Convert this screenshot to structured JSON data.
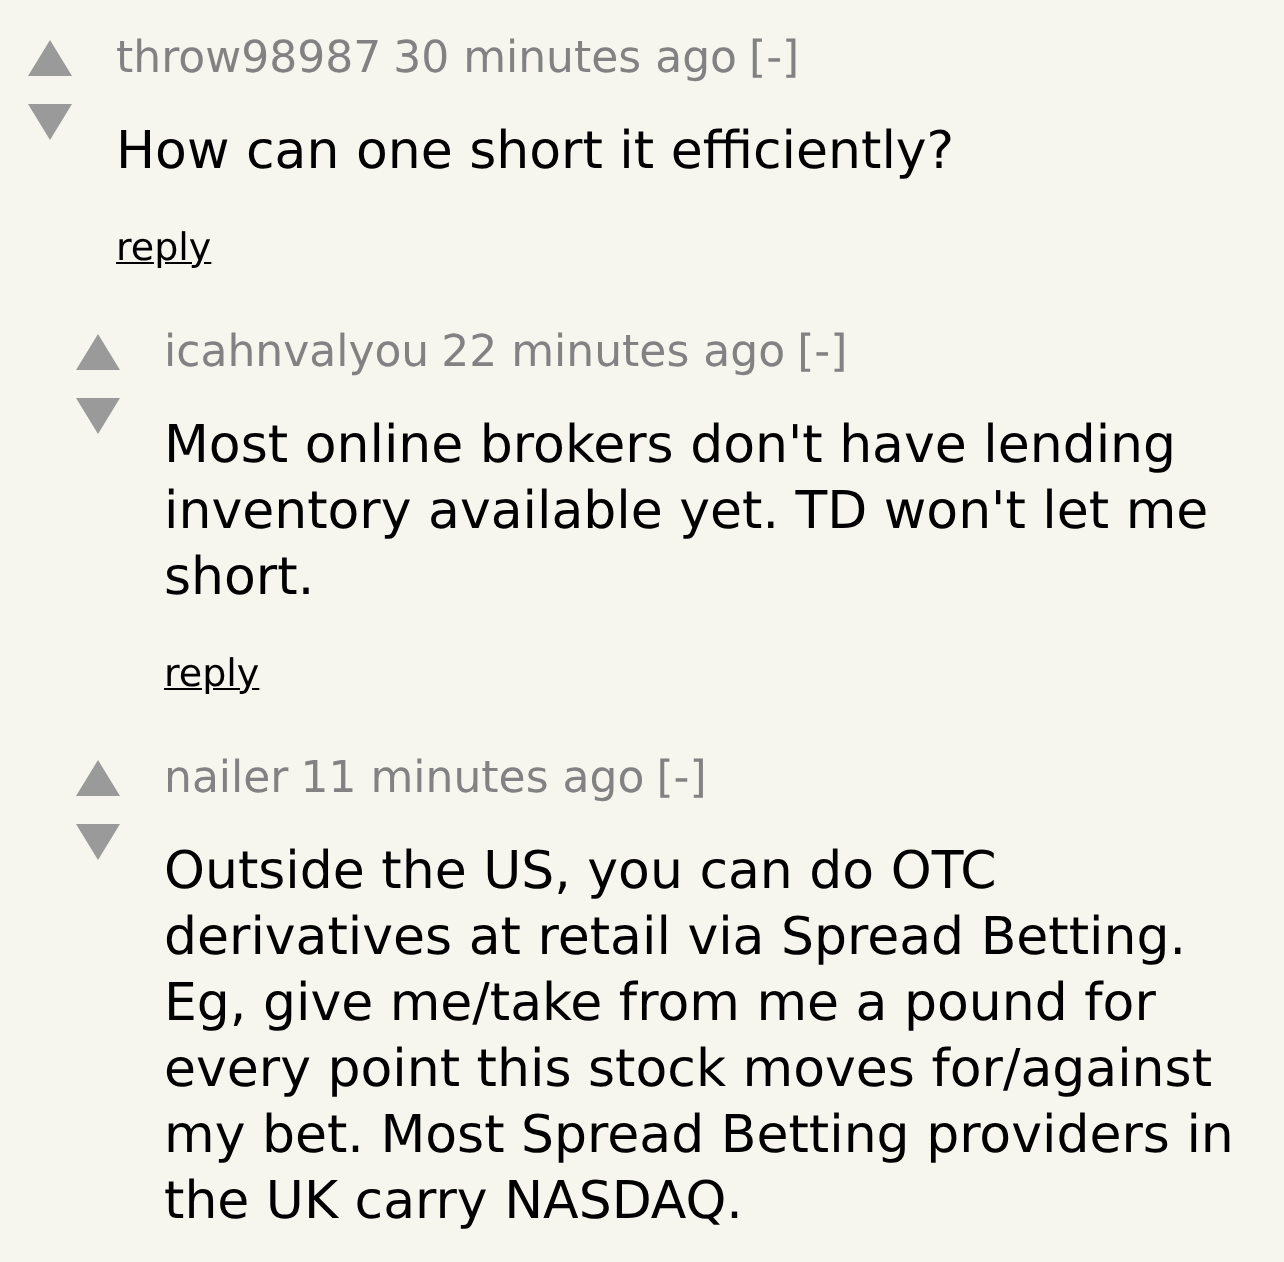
{
  "comments": [
    {
      "user": "throw98987",
      "age": "30 minutes ago",
      "toggle": "[-]",
      "text": "How can one short it efficiently?",
      "reply": "reply",
      "children": [
        {
          "user": "icahnvalyou",
          "age": "22 minutes ago",
          "toggle": "[-]",
          "text": "Most online brokers don't have lending inventory available yet. TD won't let me short.",
          "reply": "reply"
        },
        {
          "user": "nailer",
          "age": "11 minutes ago",
          "toggle": "[-]",
          "text": "Outside the US, you can do OTC derivatives at retail via Spread Betting. Eg, give me/take from me a pound for every point this stock moves for/against my bet. Most Spread Betting providers in the UK carry NASDAQ."
        }
      ]
    }
  ]
}
